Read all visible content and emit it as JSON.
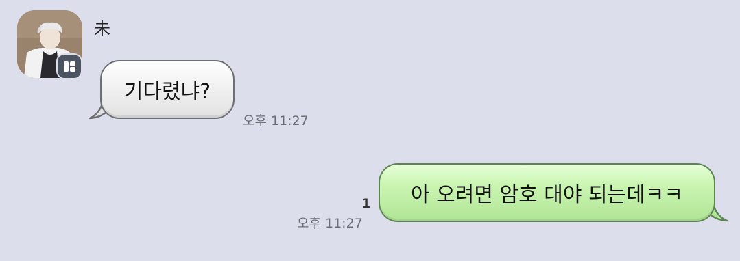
{
  "chat": {
    "incoming": {
      "sender_name": "未",
      "avatar_icon": "profile-avatar",
      "badge_icon": "multi-profile-badge-icon",
      "text": "기다렸냐?",
      "time": "오후 11:27"
    },
    "outgoing": {
      "text": "아 오려면 암호 대야 되는데ㅋㅋ",
      "time": "오후 11:27",
      "unread_count": "1"
    }
  },
  "colors": {
    "background": "#dcdfeb",
    "incoming_bubble": "#f0f0f0",
    "outgoing_bubble": "#c4f0aa",
    "time_text": "#6b6e75"
  }
}
